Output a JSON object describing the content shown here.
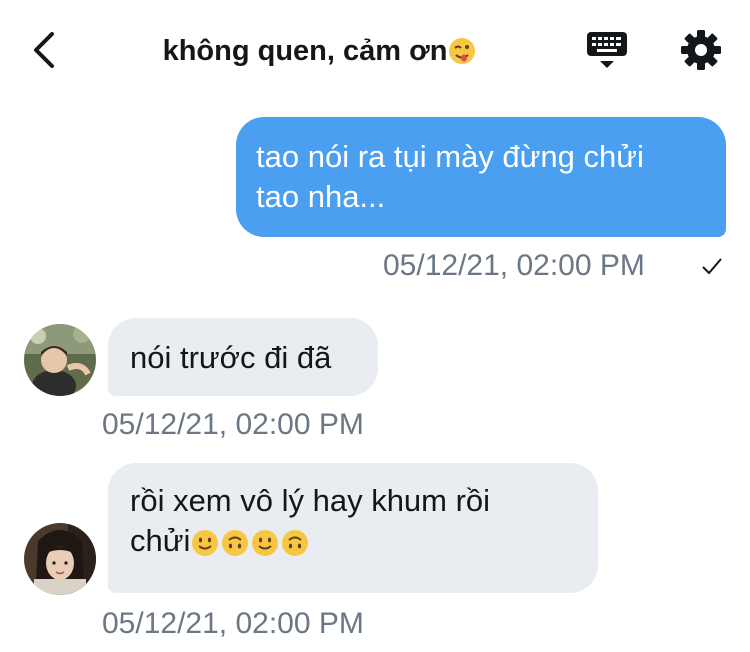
{
  "header": {
    "title": "không quen, cảm ơn",
    "title_emoji": "face-with-tongue-winking-emoji",
    "back_icon": "chevron-left-icon",
    "keyboard_icon": "keyboard-icon",
    "settings_icon": "gear-icon"
  },
  "messages": [
    {
      "direction": "outgoing",
      "line1": "tao nói ra tụi mày đừng chửi",
      "line2": "tao nha...",
      "timestamp": "05/12/21, 02:00 PM",
      "status_icon": "checkmark-icon"
    },
    {
      "direction": "incoming",
      "text": "nói trước đi đã",
      "timestamp": "05/12/21, 02:00 PM"
    },
    {
      "direction": "incoming",
      "line1": "rồi xem vô lý hay khum rồi",
      "line2": "chửi",
      "emojis": [
        "slightly-smiling-face",
        "upside-down-face",
        "slightly-smiling-face",
        "upside-down-face"
      ],
      "timestamp": "05/12/21, 02:00 PM"
    }
  ],
  "colors": {
    "outgoing_bubble": "#4a9ff0",
    "incoming_bubble": "#e9ecf0",
    "timestamp": "#6b7785"
  }
}
